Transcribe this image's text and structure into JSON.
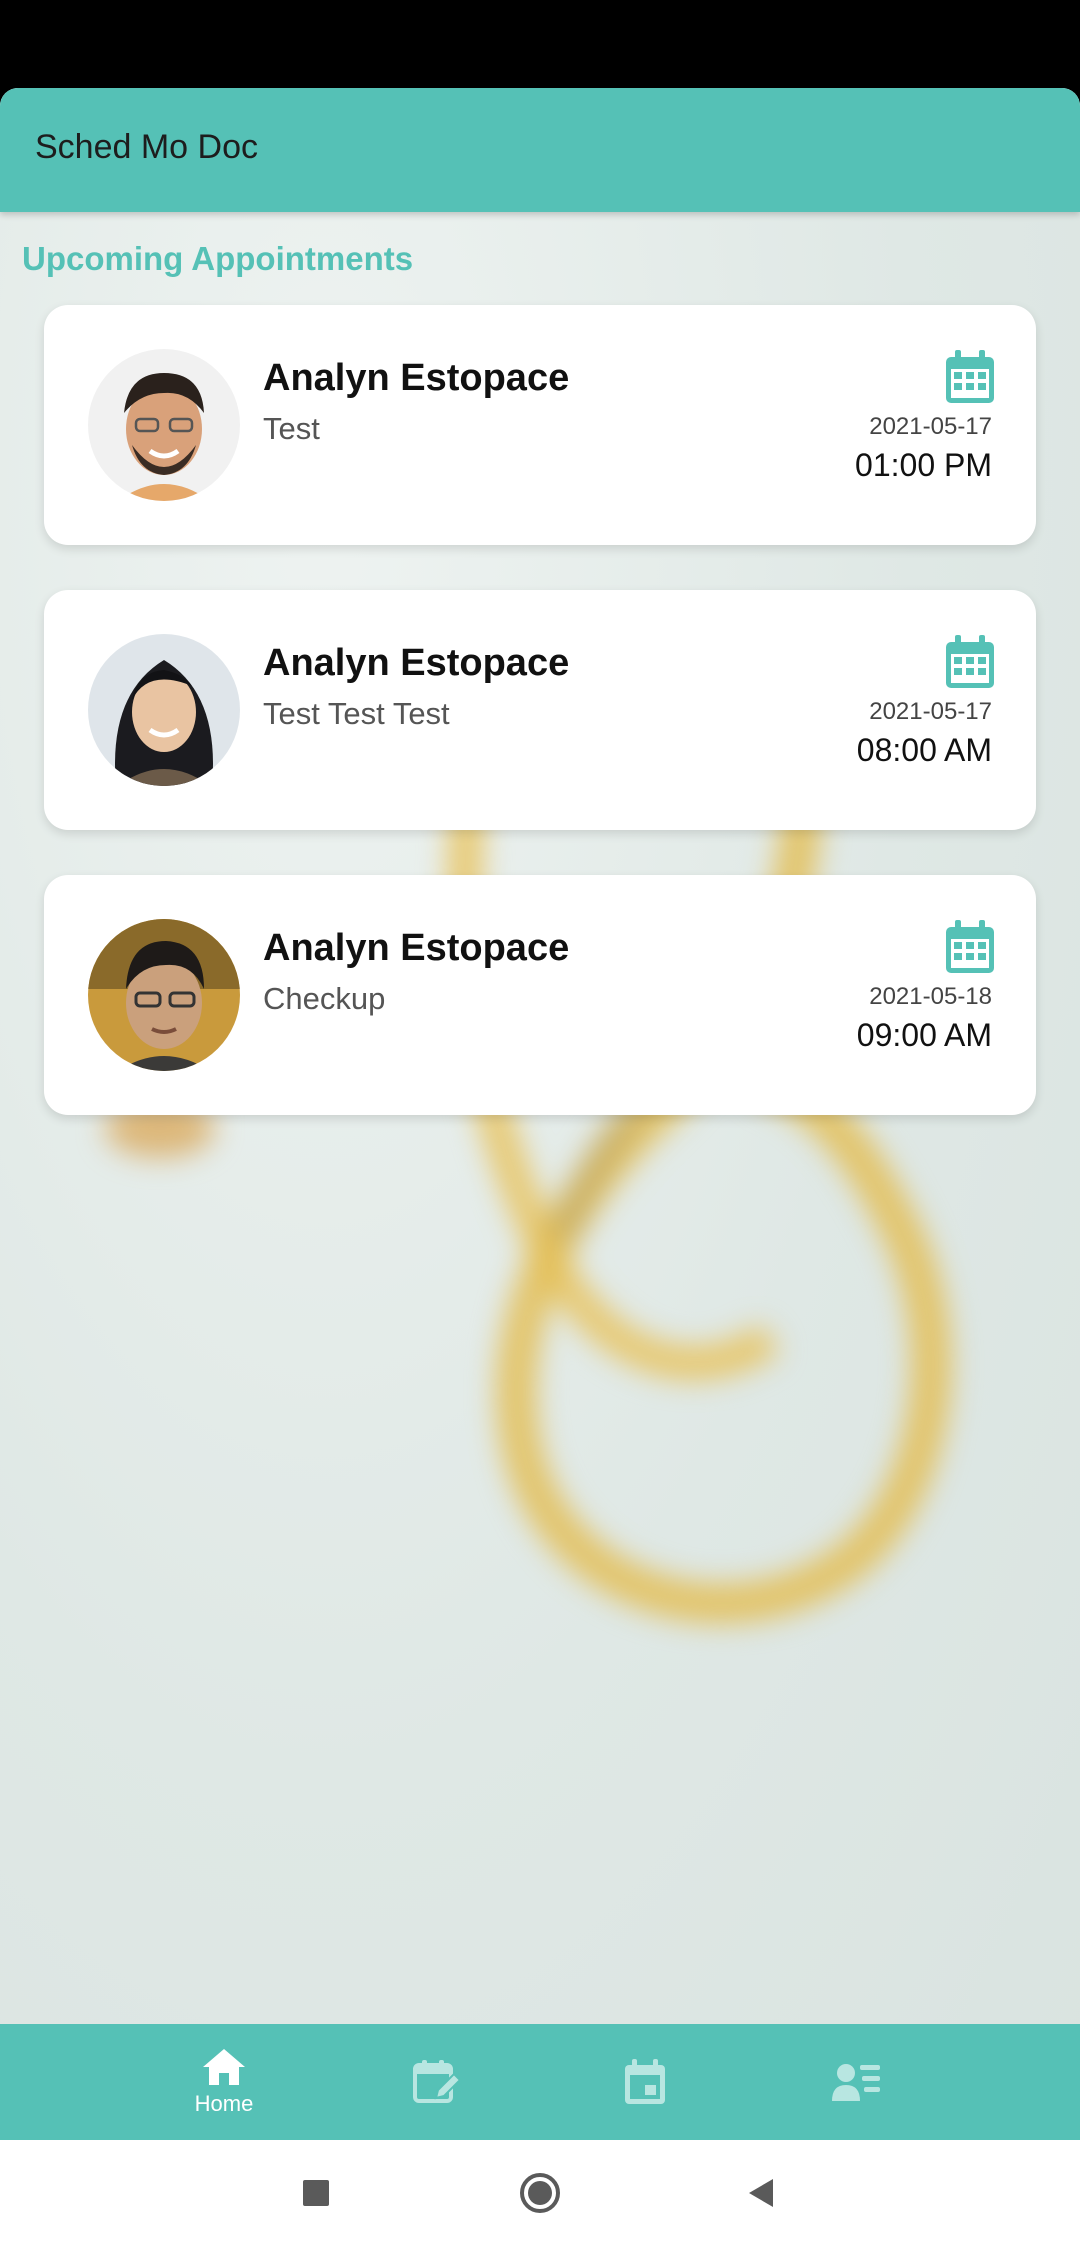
{
  "app": {
    "title": "Sched Mo Doc",
    "accent": "#55c1b6"
  },
  "section": {
    "title": "Upcoming Appointments"
  },
  "appointments": [
    {
      "name": "Analyn Estopace",
      "description": "Test",
      "date": "2021-05-17",
      "time": "01:00 PM"
    },
    {
      "name": "Analyn Estopace",
      "description": "Test Test Test",
      "date": "2021-05-17",
      "time": "08:00 AM"
    },
    {
      "name": "Analyn Estopace",
      "description": "Checkup",
      "date": "2021-05-18",
      "time": "09:00 AM"
    }
  ],
  "bottom_nav": {
    "items": [
      {
        "icon": "home-icon",
        "label": "Home",
        "active": true
      },
      {
        "icon": "calendar-edit-icon",
        "label": ""
      },
      {
        "icon": "calendar-event-icon",
        "label": ""
      },
      {
        "icon": "profile-list-icon",
        "label": ""
      }
    ]
  },
  "system_nav": {
    "icons": [
      "recents-square-icon",
      "home-circle-icon",
      "back-triangle-icon"
    ]
  }
}
